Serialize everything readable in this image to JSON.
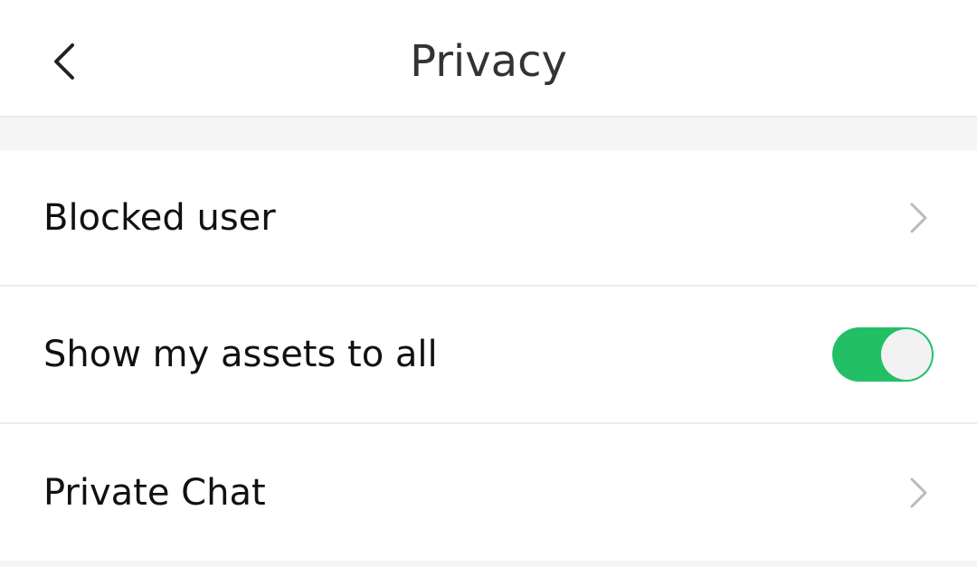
{
  "header": {
    "title": "Privacy",
    "back_icon": "chevron-left-icon"
  },
  "settings": {
    "blocked_user": {
      "label": "Blocked user",
      "icon": "chevron-right-icon"
    },
    "show_assets": {
      "label": "Show my assets to all",
      "enabled": true
    },
    "private_chat": {
      "label": "Private Chat",
      "icon": "chevron-right-icon"
    }
  },
  "colors": {
    "toggle_on": "#22c065",
    "header_bg": "#ffffff",
    "page_bg": "#f5f5f5",
    "divider": "#ececec"
  }
}
